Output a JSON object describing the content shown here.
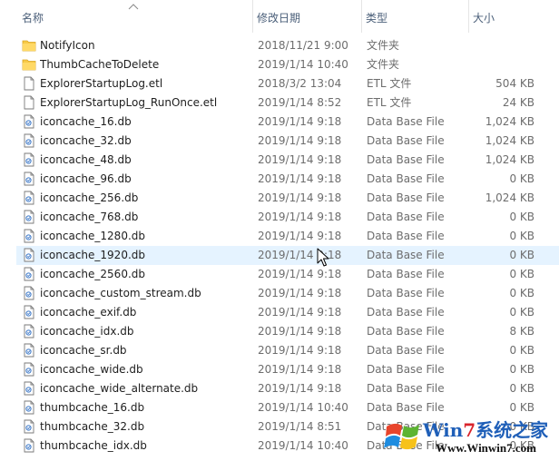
{
  "columns": {
    "name": "名称",
    "date": "修改日期",
    "type": "类型",
    "size": "大小"
  },
  "files": [
    {
      "name": "NotifyIcon",
      "date": "2018/11/21 9:00",
      "type": "文件夹",
      "size": "",
      "icon": "folder-icon"
    },
    {
      "name": "ThumbCacheToDelete",
      "date": "2019/1/14 10:40",
      "type": "文件夹",
      "size": "",
      "icon": "folder-icon"
    },
    {
      "name": "ExplorerStartupLog.etl",
      "date": "2018/3/2 13:04",
      "type": "ETL 文件",
      "size": "504 KB",
      "icon": "file-icon"
    },
    {
      "name": "ExplorerStartupLog_RunOnce.etl",
      "date": "2019/1/14 8:52",
      "type": "ETL 文件",
      "size": "24 KB",
      "icon": "file-icon"
    },
    {
      "name": "iconcache_16.db",
      "date": "2019/1/14 9:18",
      "type": "Data Base File",
      "size": "1,024 KB",
      "icon": "db-file-icon"
    },
    {
      "name": "iconcache_32.db",
      "date": "2019/1/14 9:18",
      "type": "Data Base File",
      "size": "1,024 KB",
      "icon": "db-file-icon"
    },
    {
      "name": "iconcache_48.db",
      "date": "2019/1/14 9:18",
      "type": "Data Base File",
      "size": "1,024 KB",
      "icon": "db-file-icon"
    },
    {
      "name": "iconcache_96.db",
      "date": "2019/1/14 9:18",
      "type": "Data Base File",
      "size": "0 KB",
      "icon": "db-file-icon"
    },
    {
      "name": "iconcache_256.db",
      "date": "2019/1/14 9:18",
      "type": "Data Base File",
      "size": "1,024 KB",
      "icon": "db-file-icon"
    },
    {
      "name": "iconcache_768.db",
      "date": "2019/1/14 9:18",
      "type": "Data Base File",
      "size": "0 KB",
      "icon": "db-file-icon"
    },
    {
      "name": "iconcache_1280.db",
      "date": "2019/1/14 9:18",
      "type": "Data Base File",
      "size": "0 KB",
      "icon": "db-file-icon"
    },
    {
      "name": "iconcache_1920.db",
      "date": "2019/1/14 9:18",
      "type": "Data Base File",
      "size": "0 KB",
      "icon": "db-file-icon",
      "hover": true
    },
    {
      "name": "iconcache_2560.db",
      "date": "2019/1/14 9:18",
      "type": "Data Base File",
      "size": "0 KB",
      "icon": "db-file-icon"
    },
    {
      "name": "iconcache_custom_stream.db",
      "date": "2019/1/14 9:18",
      "type": "Data Base File",
      "size": "0 KB",
      "icon": "db-file-icon"
    },
    {
      "name": "iconcache_exif.db",
      "date": "2019/1/14 9:18",
      "type": "Data Base File",
      "size": "0 KB",
      "icon": "db-file-icon"
    },
    {
      "name": "iconcache_idx.db",
      "date": "2019/1/14 9:18",
      "type": "Data Base File",
      "size": "8 KB",
      "icon": "db-file-icon"
    },
    {
      "name": "iconcache_sr.db",
      "date": "2019/1/14 9:18",
      "type": "Data Base File",
      "size": "0 KB",
      "icon": "db-file-icon"
    },
    {
      "name": "iconcache_wide.db",
      "date": "2019/1/14 9:18",
      "type": "Data Base File",
      "size": "0 KB",
      "icon": "db-file-icon"
    },
    {
      "name": "iconcache_wide_alternate.db",
      "date": "2019/1/14 9:18",
      "type": "Data Base File",
      "size": "0 KB",
      "icon": "db-file-icon"
    },
    {
      "name": "thumbcache_16.db",
      "date": "2019/1/14 10:40",
      "type": "Data Base File",
      "size": "0 KB",
      "icon": "db-file-icon"
    },
    {
      "name": "thumbcache_32.db",
      "date": "2019/1/14 8:51",
      "type": "Data Base File",
      "size": "0 KB",
      "icon": "db-file-icon"
    },
    {
      "name": "thumbcache_idx.db",
      "date": "2019/1/14 10:40",
      "type": "Data Base File",
      "size": "0 KB",
      "icon": "db-file-icon"
    }
  ],
  "watermark": {
    "brand_prefix": "Win",
    "brand_seven": "7",
    "brand_suffix": "系统之家",
    "url": "Www.Winwin7.com"
  },
  "colors": {
    "hover_row": "#e5f3ff",
    "header_text": "#4c607a",
    "folder": "#f7c948",
    "brand_blue": "#1f5fb8",
    "brand_red": "#d9242b"
  }
}
